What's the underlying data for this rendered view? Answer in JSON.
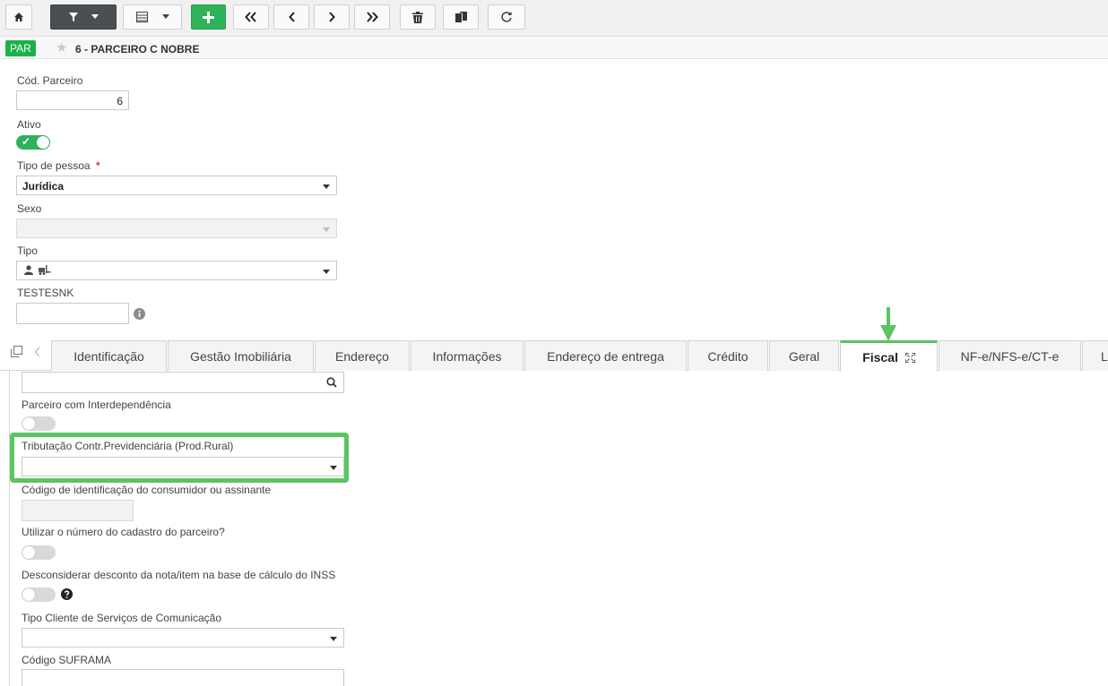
{
  "toolbar": {
    "buttons": [
      {
        "name": "home-button",
        "icon": "home-icon"
      },
      {
        "name": "filter-button",
        "icon": "filter-icon"
      },
      {
        "name": "grid-view-button",
        "icon": "table-icon"
      },
      {
        "name": "add-button",
        "icon": "plus-icon"
      },
      {
        "name": "first-record-button",
        "icon": "double-chevron-left-icon"
      },
      {
        "name": "previous-record-button",
        "icon": "chevron-left-icon"
      },
      {
        "name": "next-record-button",
        "icon": "chevron-right-icon"
      },
      {
        "name": "last-record-button",
        "icon": "double-chevron-right-icon"
      },
      {
        "name": "delete-button",
        "icon": "trash-icon"
      },
      {
        "name": "duplicate-button",
        "icon": "copy-icon"
      },
      {
        "name": "refresh-button",
        "icon": "refresh-icon"
      }
    ]
  },
  "record": {
    "badge": "PAR",
    "title": "6 - PARCEIRO C NOBRE"
  },
  "form": {
    "cod_parceiro": {
      "label": "Cód. Parceiro",
      "value": "6"
    },
    "ativo": {
      "label": "Ativo",
      "on": true
    },
    "tipo_pessoa": {
      "label": "Tipo de pessoa",
      "required_mark": "*",
      "value": "Jurídica"
    },
    "sexo": {
      "label": "Sexo",
      "value": ""
    },
    "tipo": {
      "label": "Tipo",
      "icons": [
        "person-icon",
        "forklift-icon"
      ]
    },
    "testesnk": {
      "label": "TESTESNK",
      "value": ""
    }
  },
  "tabs": [
    {
      "label": "Identificação",
      "active": false
    },
    {
      "label": "Gestão Imobiliária",
      "active": false
    },
    {
      "label": "Endereço",
      "active": false
    },
    {
      "label": "Informações",
      "active": false
    },
    {
      "label": "Endereço de entrega",
      "active": false
    },
    {
      "label": "Crédito",
      "active": false
    },
    {
      "label": "Geral",
      "active": false
    },
    {
      "label": "Fiscal",
      "active": true
    },
    {
      "label": "NF-e/NFS-e/CT-e",
      "active": false
    },
    {
      "label": "L",
      "active": false
    }
  ],
  "fiscal": {
    "search_value": "",
    "interdependencia": {
      "label": "Parceiro com Interdependência",
      "on": false
    },
    "tributacao": {
      "label": "Tributação Contr.Previdenciária (Prod.Rural)",
      "value": ""
    },
    "codigo_consumidor": {
      "label": "Código de identificação do consumidor ou assinante",
      "value": ""
    },
    "utilizar_numero": {
      "label": "Utilizar o número do cadastro do parceiro?",
      "on": false
    },
    "desconsiderar": {
      "label": "Desconsiderar desconto da nota/item na base de cálculo do INSS",
      "on": false
    },
    "tipo_cliente": {
      "label": "Tipo Cliente de Serviços de Comunicação",
      "value": ""
    },
    "suframa": {
      "label": "Código SUFRAMA",
      "value": ""
    }
  },
  "colors": {
    "accent_green": "#2eb35b",
    "highlight_green": "#5cc463",
    "toolbar_dark": "#4a4f54",
    "required_red": "#e53935"
  }
}
